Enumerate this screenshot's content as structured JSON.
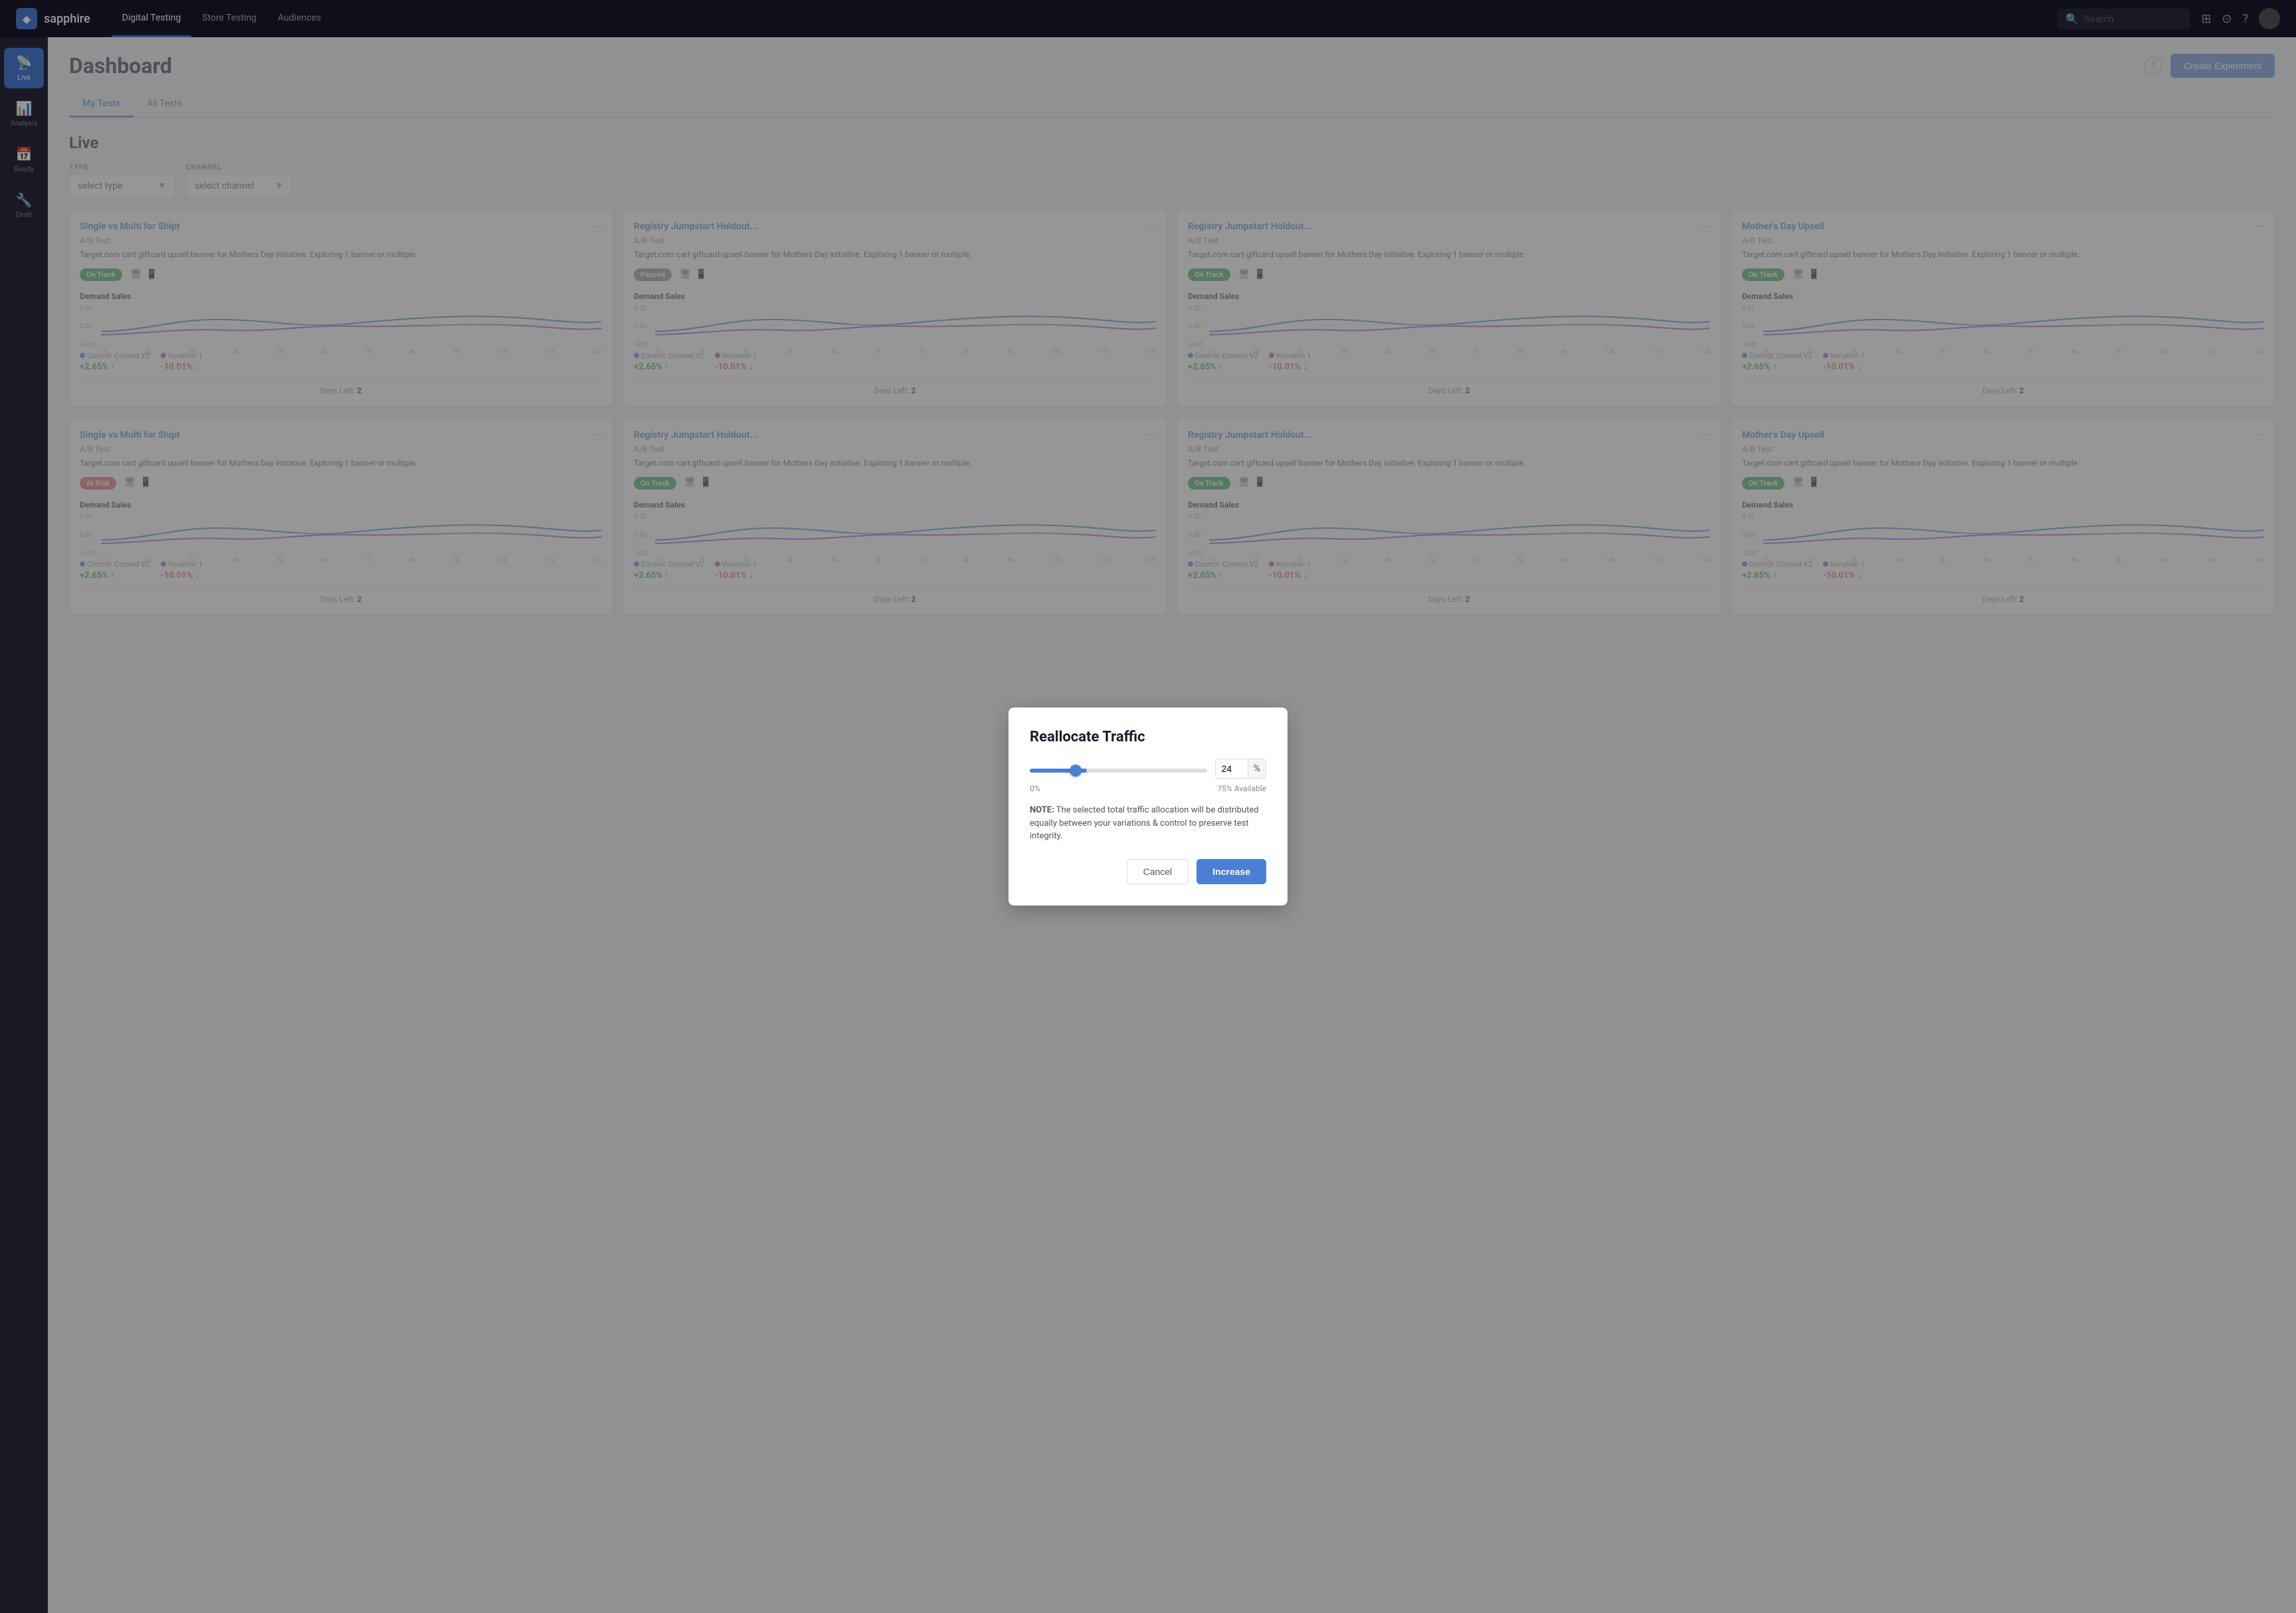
{
  "app": {
    "name": "sapphire",
    "logo_symbol": "◆"
  },
  "nav": {
    "links": [
      {
        "label": "Digital Testing",
        "active": true
      },
      {
        "label": "Store Testing",
        "active": false
      },
      {
        "label": "Audiences",
        "active": false
      }
    ],
    "search_placeholder": "Search"
  },
  "sidebar": {
    "items": [
      {
        "id": "live",
        "label": "Live",
        "icon": "📡",
        "active": true
      },
      {
        "id": "analysis",
        "label": "Analysis",
        "icon": "📊",
        "active": false
      },
      {
        "id": "ready",
        "label": "Ready",
        "icon": "📅",
        "active": false
      },
      {
        "id": "draft",
        "label": "Draft",
        "icon": "🔧",
        "active": false
      }
    ]
  },
  "page": {
    "title": "Dashboard",
    "help_label": "?",
    "create_btn": "Create Experiment"
  },
  "tabs": [
    {
      "label": "My Tests",
      "active": true
    },
    {
      "label": "All Tests",
      "active": false
    }
  ],
  "live_section": {
    "title": "Live",
    "filters": {
      "type_label": "TYPE",
      "type_placeholder": "select type",
      "channel_label": "CHANNEL",
      "channel_placeholder": "select channel"
    }
  },
  "cards_row1": [
    {
      "title": "Single vs Multi for Shipt",
      "type": "A/B Test",
      "desc": "Target.com cart giftcard upsell banner for Mothers Day initiative. Exploring 1 banner or multiple.",
      "badge": "On Track",
      "badge_type": "green",
      "metric_title": "Demand Sales",
      "y_vals": [
        "4.00",
        "0.00",
        "-4.00"
      ],
      "control_label": "Control: Context V2",
      "control_val": "+2.65%",
      "control_dir": "up",
      "variation_label": "Variation 1",
      "variation_val": "-10.01%",
      "variation_dir": "down",
      "days_left_label": "Days Left:",
      "days_left": "2"
    },
    {
      "title": "Registry Jumpstart Holdout...",
      "type": "A/B Test",
      "desc": "Target.com cart giftcard upsell banner for Mothers Day initiative. Exploring 1 banner or multiple.",
      "badge": "Paused",
      "badge_type": "paused",
      "metric_title": "Demand Sales",
      "y_vals": [
        "4.00",
        "0.00",
        "-4.00"
      ],
      "control_label": "Control: Context V2",
      "control_val": "+2.65%",
      "control_dir": "up",
      "variation_label": "Variation 1",
      "variation_val": "-10.01%",
      "variation_dir": "down",
      "days_left_label": "Days Left:",
      "days_left": "2"
    },
    {
      "title": "Registry Jumpstart Holdout...",
      "type": "A/B Test",
      "desc": "Target.com cart giftcard upsell banner for Mothers Day initiative. Exploring 1 banner or multiple.",
      "badge": "On Track",
      "badge_type": "green",
      "metric_title": "Demand Sales",
      "y_vals": [
        "4.00",
        "0.00",
        "-4.00"
      ],
      "control_label": "Control: Context V2",
      "control_val": "+2.65%",
      "control_dir": "up",
      "variation_label": "Variation 1",
      "variation_val": "-10.01%",
      "variation_dir": "down",
      "days_left_label": "Days Left:",
      "days_left": "2"
    },
    {
      "title": "Mother's Day Upsell",
      "type": "A/B Test",
      "desc": "Target.com cart giftcard upsell banner for Mothers Day initiative. Exploring 1 banner or multiple.",
      "badge": "On Track",
      "badge_type": "green",
      "metric_title": "Demand Sales",
      "y_vals": [
        "4.00",
        "0.00",
        "-4.00"
      ],
      "control_label": "Control: Context V2",
      "control_val": "+2.65%",
      "control_dir": "up",
      "variation_label": "Variation 1",
      "variation_val": "-10.01%",
      "variation_dir": "down",
      "days_left_label": "Days Left:",
      "days_left": "2"
    }
  ],
  "cards_row2": [
    {
      "title": "Single vs Multi for Shipt",
      "type": "A/B Test",
      "desc": "Target.com cart giftcard upsell banner for Mothers Day initiative. Exploring 1 banner or multiple.",
      "badge": "At Risk",
      "badge_type": "red",
      "metric_title": "Demand Sales",
      "y_vals": [
        "4.00",
        "0.00",
        "-4.00"
      ],
      "control_label": "Control: Context V2",
      "control_val": "+2.65%",
      "control_dir": "up",
      "variation_label": "Variation 1",
      "variation_val": "-10.01%",
      "variation_dir": "down",
      "days_left_label": "Days Left:",
      "days_left": "2"
    },
    {
      "title": "Registry Jumpstart Holdout...",
      "type": "A/B Test",
      "desc": "Target.com cart giftcard upsell banner for Mothers Day initiative. Exploring 1 banner or multiple.",
      "badge": "On Track",
      "badge_type": "green",
      "metric_title": "Demand Sales",
      "y_vals": [
        "4.00",
        "0.00",
        "-4.00"
      ],
      "control_label": "Control: Context V2",
      "control_val": "+2.65%",
      "control_dir": "up",
      "variation_label": "Variation 1",
      "variation_val": "-10.01%",
      "variation_dir": "down",
      "days_left_label": "Days Left:",
      "days_left": "2"
    },
    {
      "title": "Registry Jumpstart Holdout...",
      "type": "A/B Test",
      "desc": "Target.com cart giftcard upsell banner for Mothers Day initiative. Exploring 1 banner or multiple.",
      "badge": "On Track",
      "badge_type": "green",
      "metric_title": "Demand Sales",
      "y_vals": [
        "4.00",
        "0.00",
        "-4.00"
      ],
      "control_label": "Control: Context V2",
      "control_val": "+2.65%",
      "control_dir": "up",
      "variation_label": "Variation 1",
      "variation_val": "-10.01%",
      "variation_dir": "down",
      "days_left_label": "Days Left:",
      "days_left": "2"
    },
    {
      "title": "Mother's Day Upsell",
      "type": "A/B Test",
      "desc": "Target.com cart giftcard upsell banner for Mothers Day initiative. Exploring 1 banner or multiple.",
      "badge": "On Track",
      "badge_type": "green",
      "metric_title": "Demand Sales",
      "y_vals": [
        "4.00",
        "0.00",
        "-4.00"
      ],
      "control_label": "Control: Context V2",
      "control_val": "+2.65%",
      "control_dir": "up",
      "variation_label": "Variation 1",
      "variation_val": "-10.01%",
      "variation_dir": "down",
      "days_left_label": "Days Left:",
      "days_left": "2"
    }
  ],
  "modal": {
    "title": "Reallocate Traffic",
    "slider_value": 24,
    "slider_max": 100,
    "percent_symbol": "%",
    "min_label": "0%",
    "available_label": "75% Available",
    "note": "NOTE: The selected total traffic allocation will be distributed equally between your variations & control to preserve test integrity.",
    "cancel_label": "Cancel",
    "increase_label": "Increase"
  }
}
